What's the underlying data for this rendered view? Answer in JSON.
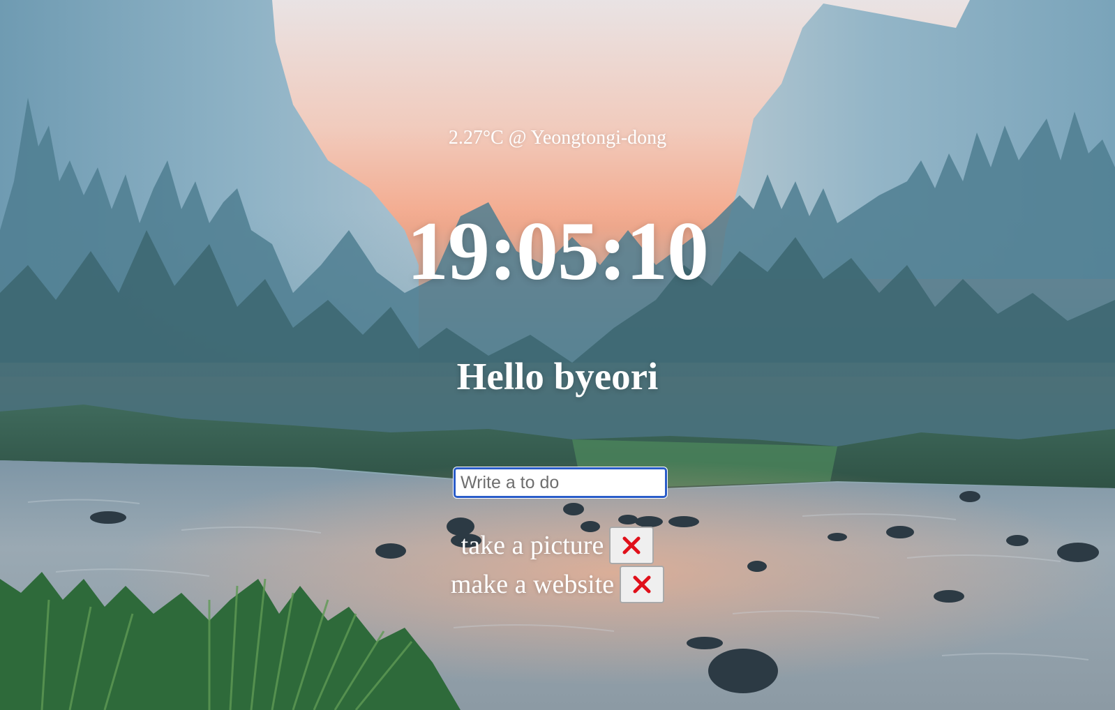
{
  "weather": {
    "temperature": "2.27°C",
    "separator": "@",
    "location": "Yeongtongi-dong"
  },
  "clock": {
    "time": "19:05:10"
  },
  "greeting": {
    "text": "Hello byeori"
  },
  "todo": {
    "placeholder": "Write a to do",
    "value": "",
    "items": [
      {
        "text": "take a picture",
        "delete_icon": "red-x-icon"
      },
      {
        "text": "make a website",
        "delete_icon": "red-x-icon"
      }
    ]
  },
  "colors": {
    "text": "#ffffff",
    "input_focus_border": "#2a5cc8",
    "delete_x": "#e0101a",
    "sky_glow": "#f3a88a"
  },
  "background": {
    "scene": "mountain-valley-river-landscape"
  }
}
